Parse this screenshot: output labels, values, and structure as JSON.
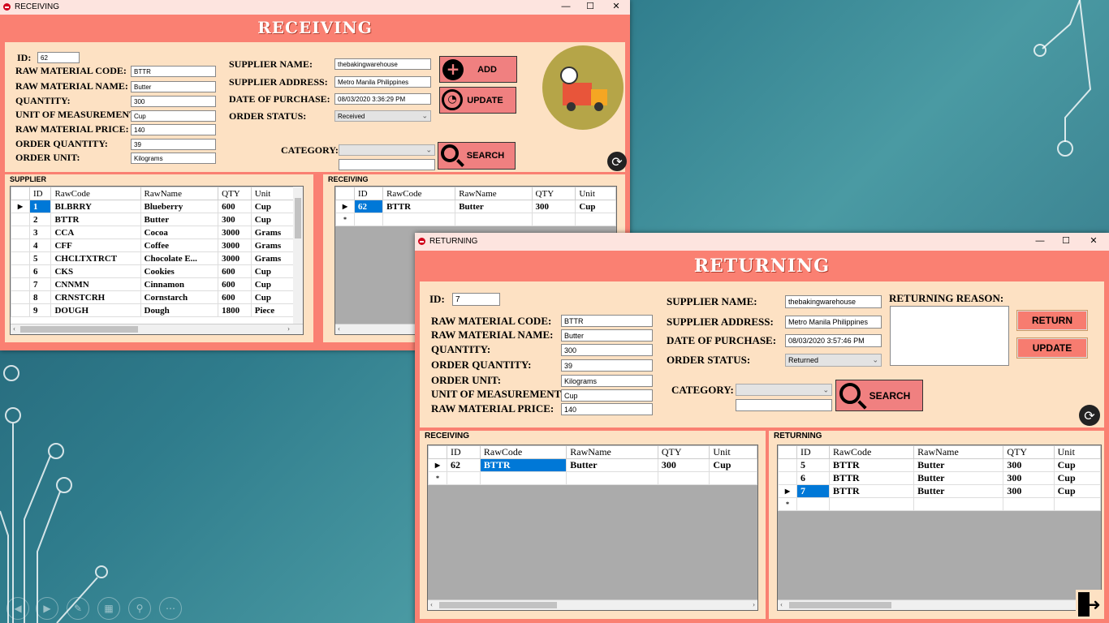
{
  "receiving": {
    "window_title": "RECEIVING",
    "banner": "RECEIVING",
    "form": {
      "id_label": "ID:",
      "id_value": "62",
      "code_label": "RAW MATERIAL CODE:",
      "code_value": "BTTR",
      "name_label": "RAW MATERIAL NAME:",
      "name_value": "Butter",
      "qty_label": "QUANTITY:",
      "qty_value": "300",
      "uom_label": "UNIT OF MEASUREMENT:",
      "uom_value": "Cup",
      "price_label": "RAW MATERIAL PRICE:",
      "price_value": "140",
      "oqty_label": "ORDER QUANTITY:",
      "oqty_value": "39",
      "ounit_label": "ORDER UNIT:",
      "ounit_value": "Kilograms",
      "sname_label": "SUPPLIER NAME:",
      "sname_value": "thebakingwarehouse",
      "saddr_label": "SUPPLIER ADDRESS:",
      "saddr_value": "Metro Manila Philippines",
      "date_label": "DATE OF PURCHASE:",
      "date_value": "08/03/2020 3:36:29 PM",
      "status_label": "ORDER STATUS:",
      "status_value": "Received",
      "category_label": "CATEGORY:",
      "category_value": "",
      "search_value": ""
    },
    "buttons": {
      "add": "ADD",
      "update": "UPDATE",
      "search": "SEARCH"
    },
    "supplier_grid": {
      "title": "SUPPLIER",
      "columns": [
        "ID",
        "RawCode",
        "RawName",
        "QTY",
        "Unit"
      ],
      "rows": [
        [
          "1",
          "BLBRRY",
          "Blueberry",
          "600",
          "Cup"
        ],
        [
          "2",
          "BTTR",
          "Butter",
          "300",
          "Cup"
        ],
        [
          "3",
          "CCA",
          "Cocoa",
          "3000",
          "Grams"
        ],
        [
          "4",
          "CFF",
          "Coffee",
          "3000",
          "Grams"
        ],
        [
          "5",
          "CHCLTXTRCT",
          "Chocolate E...",
          "3000",
          "Grams"
        ],
        [
          "6",
          "CKS",
          "Cookies",
          "600",
          "Cup"
        ],
        [
          "7",
          "CNNMN",
          "Cinnamon",
          "600",
          "Cup"
        ],
        [
          "8",
          "CRNSTCRH",
          "Cornstarch",
          "600",
          "Cup"
        ],
        [
          "9",
          "DOUGH",
          "Dough",
          "1800",
          "Piece"
        ]
      ]
    },
    "receiving_grid": {
      "title": "RECEIVING",
      "columns": [
        "ID",
        "RawCode",
        "RawName",
        "QTY",
        "Unit"
      ],
      "rows": [
        [
          "62",
          "BTTR",
          "Butter",
          "300",
          "Cup"
        ]
      ]
    }
  },
  "returning": {
    "window_title": "RETURNING",
    "banner": "RETURNING",
    "form": {
      "id_label": "ID:",
      "id_value": "7",
      "code_label": "RAW MATERIAL CODE:",
      "code_value": "BTTR",
      "name_label": "RAW MATERIAL NAME:",
      "name_value": "Butter",
      "qty_label": "QUANTITY:",
      "qty_value": "300",
      "oqty_label": "ORDER QUANTITY:",
      "oqty_value": "39",
      "ounit_label": "ORDER UNIT:",
      "ounit_value": "Kilograms",
      "uom_label": "UNIT OF MEASUREMENT:",
      "uom_value": "Cup",
      "price_label": "RAW MATERIAL PRICE:",
      "price_value": "140",
      "sname_label": "SUPPLIER NAME:",
      "sname_value": "thebakingwarehouse",
      "saddr_label": "SUPPLIER ADDRESS:",
      "saddr_value": "Metro Manila Philippines",
      "date_label": "DATE OF PURCHASE:",
      "date_value": "08/03/2020 3:57:46 PM",
      "status_label": "ORDER STATUS:",
      "status_value": "Returned",
      "category_label": "CATEGORY:",
      "category_value": "",
      "search_value": "",
      "reason_label": "RETURNING REASON:",
      "reason_value": ""
    },
    "buttons": {
      "return": "RETURN",
      "update": "UPDATE",
      "search": "SEARCH"
    },
    "receiving_grid": {
      "title": "RECEIVING",
      "columns": [
        "ID",
        "RawCode",
        "RawName",
        "QTY",
        "Unit"
      ],
      "rows": [
        [
          "62",
          "BTTR",
          "Butter",
          "300",
          "Cup"
        ]
      ]
    },
    "returning_grid": {
      "title": "RETURNING",
      "columns": [
        "ID",
        "RawCode",
        "RawName",
        "QTY",
        "Unit"
      ],
      "rows": [
        [
          "5",
          "BTTR",
          "Butter",
          "300",
          "Cup"
        ],
        [
          "6",
          "BTTR",
          "Butter",
          "300",
          "Cup"
        ],
        [
          "7",
          "BTTR",
          "Butter",
          "300",
          "Cup"
        ]
      ]
    }
  },
  "window_controls": {
    "minimize": "—",
    "maximize": "☐",
    "close": "✕"
  },
  "colors": {
    "form_bg": "#fa8072",
    "panel_bg": "#fde1c3",
    "selection": "#0078d7"
  }
}
